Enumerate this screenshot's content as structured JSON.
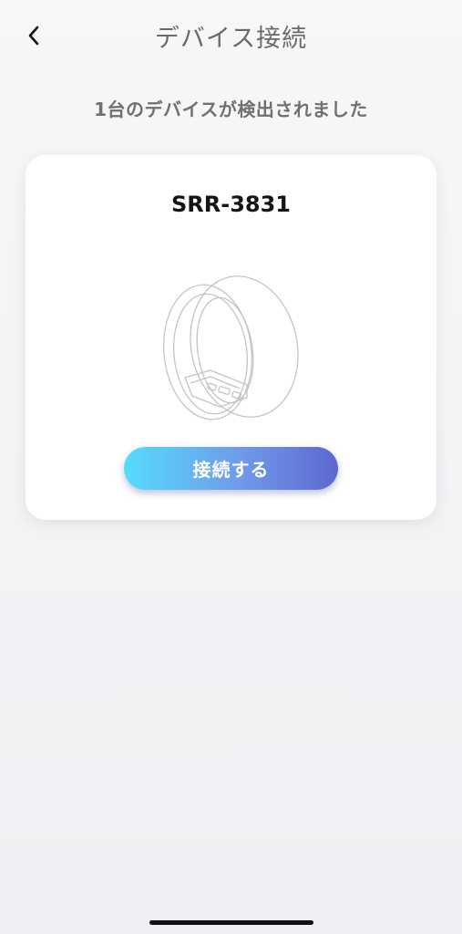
{
  "header": {
    "title": "デバイス接続",
    "back_icon": "chevron-left-icon"
  },
  "subtitle": "1台のデバイスが検出されました",
  "device": {
    "name": "SRR-3831",
    "image_icon": "smart-ring-icon",
    "connect_label": "接続する"
  },
  "colors": {
    "button_gradient_start": "#56dcfc",
    "button_gradient_end": "#5e67d2",
    "title_text": "#6a6a6a"
  }
}
